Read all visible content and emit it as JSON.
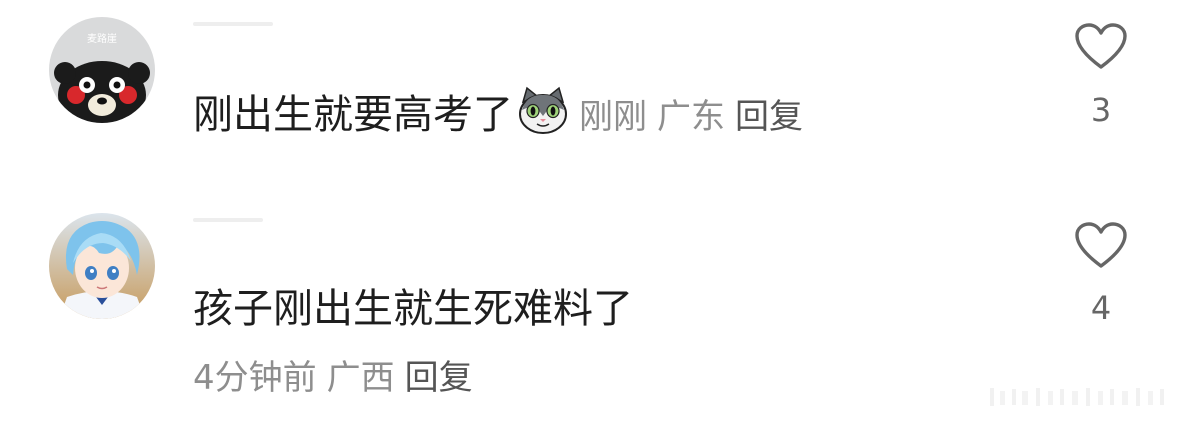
{
  "comments": [
    {
      "text": "刚出生就要高考了",
      "sticker": "grey-cat-sticker",
      "time": "刚刚",
      "location": "广东",
      "reply_label": "回复",
      "likes": "3",
      "avatar": "kumamon-avatar",
      "avatar_text": "麦路崖"
    },
    {
      "text": "孩子刚出生就生死难料了",
      "time": "4分钟前",
      "location": "广西",
      "reply_label": "回复",
      "likes": "4",
      "avatar": "anime-boy-avatar"
    }
  ],
  "icons": {
    "like": "heart-outline-icon"
  },
  "colors": {
    "text": "#1e1e1e",
    "meta": "#8e8e8e",
    "reply": "#555555",
    "icon": "#666666"
  }
}
